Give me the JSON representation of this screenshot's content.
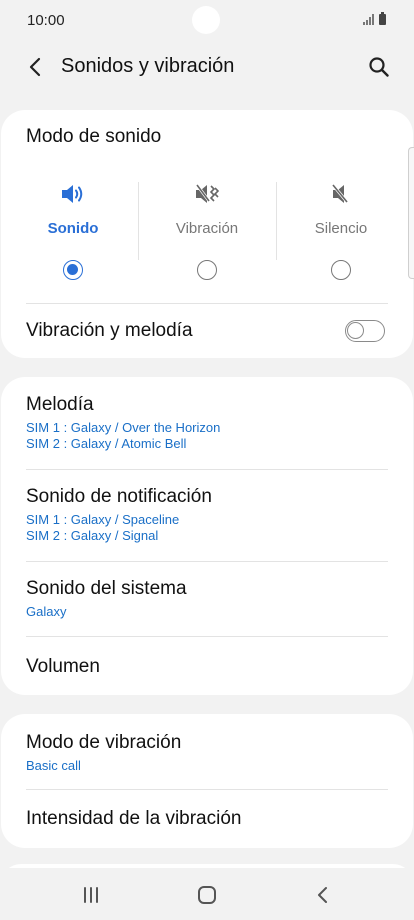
{
  "status": {
    "time": "10:00"
  },
  "header": {
    "title": "Sonidos y vibración"
  },
  "sound_mode": {
    "title": "Modo de sonido",
    "options": [
      {
        "label": "Sonido",
        "icon": "volume-icon",
        "selected": true
      },
      {
        "label": "Vibración",
        "icon": "vibrate-icon",
        "selected": false
      },
      {
        "label": "Silencio",
        "icon": "mute-icon",
        "selected": false
      }
    ],
    "toggle_label": "Vibración y melodía",
    "toggle_on": false
  },
  "ringtones": {
    "melody": {
      "title": "Melodía",
      "sim1": "SIM 1 : Galaxy / Over the Horizon",
      "sim2": "SIM 2 : Galaxy / Atomic Bell"
    },
    "notification": {
      "title": "Sonido de notificación",
      "sim1": "SIM 1 : Galaxy / Spaceline",
      "sim2": "SIM 2 : Galaxy / Signal"
    },
    "system": {
      "title": "Sonido del sistema",
      "value": "Galaxy"
    },
    "volume": {
      "title": "Volumen"
    }
  },
  "vibration": {
    "mode": {
      "title": "Modo de vibración",
      "value": "Basic call"
    },
    "intensity": {
      "title": "Intensidad de la vibración"
    }
  },
  "colors": {
    "accent": "#2a6fd6",
    "link": "#1a6fc7",
    "background": "#f2f2f2"
  }
}
